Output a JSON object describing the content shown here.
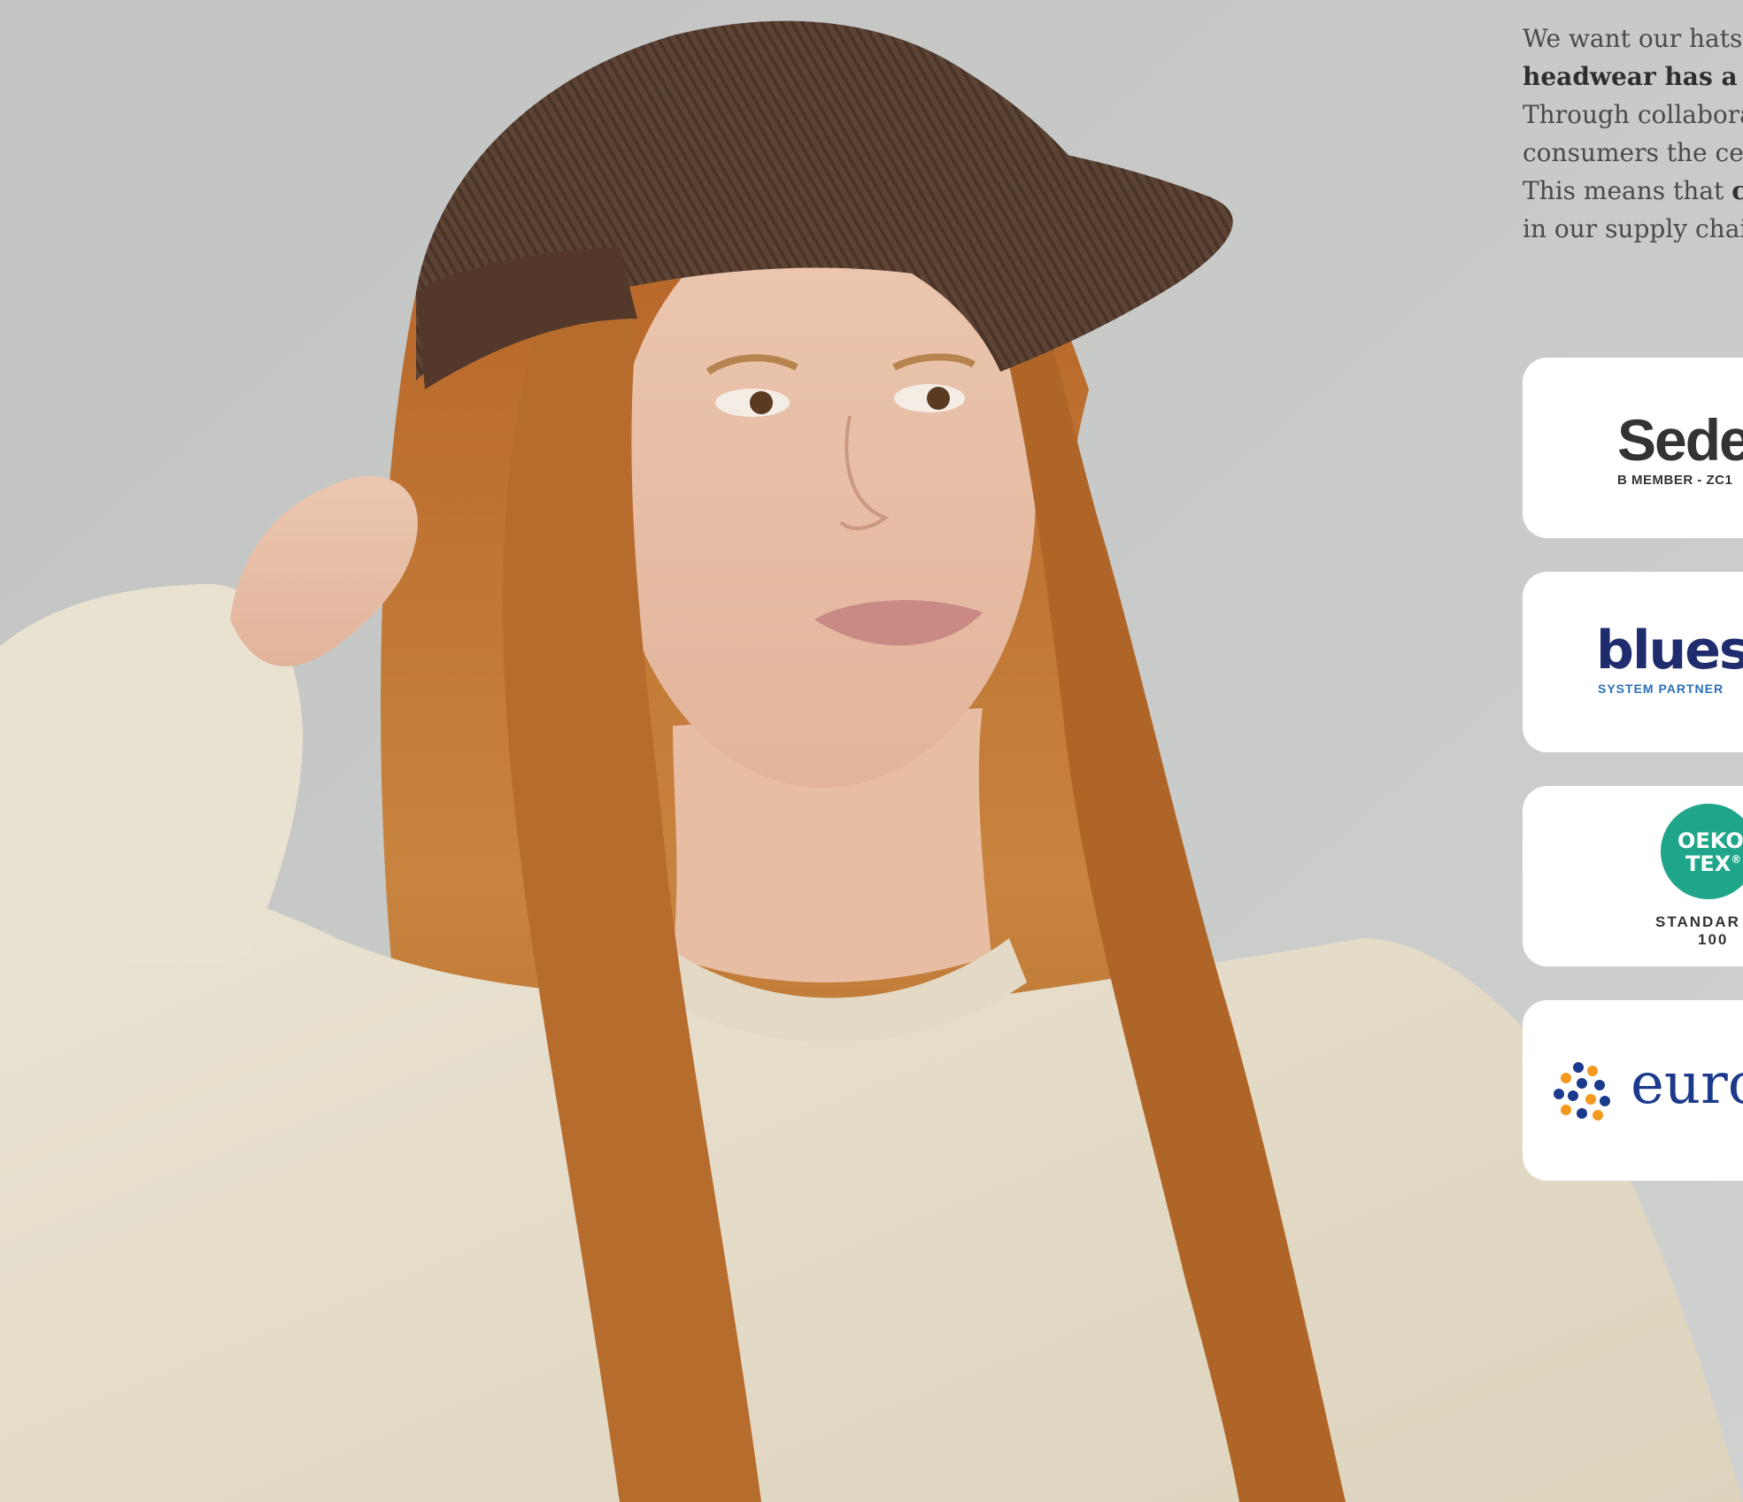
{
  "intro": {
    "line1": "We want our hats",
    "line2": "headwear has a lo",
    "line3": "Through collabora",
    "line4": "consumers the cer",
    "line5_a": "This means that ",
    "line5_b": "c",
    "line6": "in our supply chai"
  },
  "certifications": {
    "sedex": {
      "name": "Sede",
      "sub": "B MEMBER - ZC1"
    },
    "bluesign": {
      "name": "bluesi",
      "sub": "SYSTEM PARTNER"
    },
    "oeko": {
      "line1": "OEKO",
      "line2": "TEX",
      "reg": "®",
      "standard": "STANDAR",
      "number": "100"
    },
    "euro": {
      "name": "euro"
    }
  },
  "colors": {
    "background": "#c9cbca",
    "sedex": "#333333",
    "bluesign": "#1f2d6e",
    "oeko_badge": "#1fa68a",
    "euro": "#1b3a8c"
  }
}
